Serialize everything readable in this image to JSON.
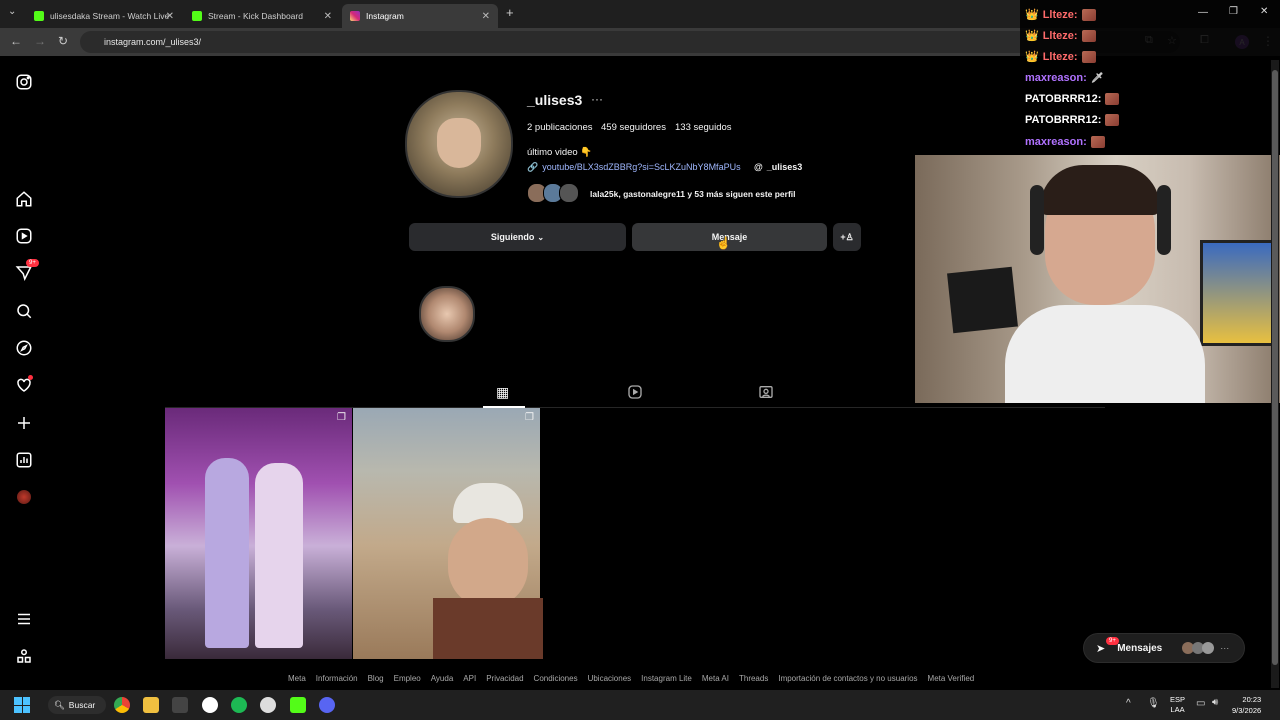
{
  "tabs": [
    {
      "label": "ulisesdaka Stream - Watch Live",
      "active": false
    },
    {
      "label": "Stream - Kick Dashboard",
      "active": false
    },
    {
      "label": "Instagram",
      "active": true
    }
  ],
  "address": "instagram.com/_ulises3/",
  "profile": {
    "username": "_ulises3",
    "posts": "2 publicaciones",
    "followers": "459 seguidores",
    "following": "133 seguidos",
    "bio": "último video 👇",
    "link": "youtube/BLX3sdZBBRg?si=ScLKZuNbY8MfaPUs",
    "threads": "_ulises3",
    "followed_by": "lala25k, gastonalegre11 y 53 más siguen este perfil",
    "following_btn": "Siguiendo",
    "message_btn": "Mensaje"
  },
  "messages_widget": {
    "label": "Mensajes",
    "badge": "9+"
  },
  "sidebar_badge": "9+",
  "footer_links": [
    "Meta",
    "Información",
    "Blog",
    "Empleo",
    "Ayuda",
    "API",
    "Privacidad",
    "Condiciones",
    "Ubicaciones",
    "Instagram Lite",
    "Meta AI",
    "Threads",
    "Importación de contactos y no usuarios",
    "Meta Verified"
  ],
  "chat": [
    {
      "user": "Llteze:",
      "color": "#ff6b6b",
      "crown": true
    },
    {
      "user": "Llteze:",
      "color": "#ff6b6b",
      "crown": true
    },
    {
      "user": "Llteze:",
      "color": "#ff6b6b",
      "crown": true
    },
    {
      "user": "maxreason:",
      "color": "#b072ff",
      "crown": false
    },
    {
      "user": "PATOBRRR12:",
      "color": "#ffffff",
      "crown": false
    },
    {
      "user": "PATOBRRR12:",
      "color": "#ffffff",
      "crown": false
    },
    {
      "user": "maxreason:",
      "color": "#b072ff",
      "crown": false
    }
  ],
  "taskbar": {
    "search": "Buscar",
    "lang": "ESP",
    "lang2": "LAA",
    "time": "20:23",
    "date": "9/3/2026"
  },
  "colors": {
    "link": "#a0b8ff",
    "accent": "#0095f6",
    "badge": "#ff3040"
  }
}
